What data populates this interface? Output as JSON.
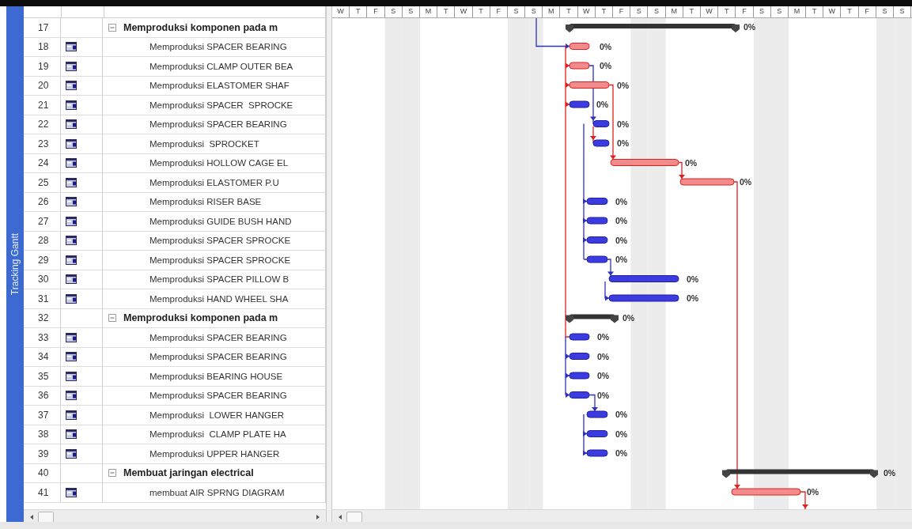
{
  "side_label": "Tracking Gantt",
  "timescale": [
    "W",
    "T",
    "F",
    "S",
    "S",
    "M",
    "T",
    "W",
    "T",
    "F",
    "S",
    "S",
    "M",
    "T",
    "W",
    "T",
    "F",
    "S",
    "S",
    "M",
    "T",
    "W",
    "T",
    "F",
    "S",
    "S",
    "M",
    "T",
    "W",
    "T",
    "F",
    "S",
    "S"
  ],
  "rows": [
    {
      "id": "17",
      "kind": "summary",
      "expanded": true,
      "name": "Memproduksi komponen pada m",
      "bar": {
        "kind": "summary",
        "label": "0%"
      }
    },
    {
      "id": "18",
      "kind": "task",
      "name": "Memproduksi SPACER BEARING",
      "bar": {
        "kind": "critical",
        "label": "0%"
      }
    },
    {
      "id": "19",
      "kind": "task",
      "name": "Memproduksi CLAMP OUTER BEA",
      "bar": {
        "kind": "critical",
        "label": "0%"
      }
    },
    {
      "id": "20",
      "kind": "task",
      "name": "Memproduksi ELASTOMER SHAF",
      "bar": {
        "kind": "critical",
        "label": "0%"
      }
    },
    {
      "id": "21",
      "kind": "task",
      "name": "Memproduksi SPACER  SPROCKE",
      "bar": {
        "kind": "normal",
        "label": "0%"
      }
    },
    {
      "id": "22",
      "kind": "task",
      "name": "Memproduksi SPACER BEARING",
      "bar": {
        "kind": "normal",
        "label": "0%"
      }
    },
    {
      "id": "23",
      "kind": "task",
      "name": "Memproduksi  SPROCKET",
      "bar": {
        "kind": "normal",
        "label": "0%"
      }
    },
    {
      "id": "24",
      "kind": "task",
      "name": "Memproduksi HOLLOW CAGE EL",
      "bar": {
        "kind": "critical",
        "label": "0%"
      }
    },
    {
      "id": "25",
      "kind": "task",
      "name": "Memproduksi ELASTOMER P.U",
      "bar": {
        "kind": "critical",
        "label": "0%"
      }
    },
    {
      "id": "26",
      "kind": "task",
      "name": "Memproduksi RISER BASE",
      "bar": {
        "kind": "normal",
        "label": "0%"
      }
    },
    {
      "id": "27",
      "kind": "task",
      "name": "Memproduksi GUIDE BUSH HAND",
      "bar": {
        "kind": "normal",
        "label": "0%"
      }
    },
    {
      "id": "28",
      "kind": "task",
      "name": "Memproduksi SPACER SPROCKE",
      "bar": {
        "kind": "normal",
        "label": "0%"
      }
    },
    {
      "id": "29",
      "kind": "task",
      "name": "Memproduksi SPACER SPROCKE",
      "bar": {
        "kind": "normal",
        "label": "0%"
      }
    },
    {
      "id": "30",
      "kind": "task",
      "name": "Memproduksi SPACER PILLOW B",
      "bar": {
        "kind": "normal",
        "label": "0%"
      }
    },
    {
      "id": "31",
      "kind": "task",
      "name": "Memproduksi HAND WHEEL SHA",
      "bar": {
        "kind": "normal",
        "label": "0%"
      }
    },
    {
      "id": "32",
      "kind": "summary",
      "expanded": true,
      "name": "Memproduksi komponen pada m",
      "bar": {
        "kind": "summary",
        "label": "0%"
      }
    },
    {
      "id": "33",
      "kind": "task",
      "name": "Memproduksi SPACER BEARING",
      "bar": {
        "kind": "normal",
        "label": "0%"
      }
    },
    {
      "id": "34",
      "kind": "task",
      "name": "Memproduksi SPACER BEARING",
      "bar": {
        "kind": "normal",
        "label": "0%"
      }
    },
    {
      "id": "35",
      "kind": "task",
      "name": "Memproduksi BEARING HOUSE",
      "bar": {
        "kind": "normal",
        "label": "0%"
      }
    },
    {
      "id": "36",
      "kind": "task",
      "name": "Memproduksi SPACER BEARING",
      "bar": {
        "kind": "normal",
        "label": "0%"
      }
    },
    {
      "id": "37",
      "kind": "task",
      "name": "Memproduksi  LOWER HANGER",
      "bar": {
        "kind": "normal",
        "label": "0%"
      }
    },
    {
      "id": "38",
      "kind": "task",
      "name": "Memproduksi  CLAMP PLATE HA",
      "bar": {
        "kind": "normal",
        "label": "0%"
      }
    },
    {
      "id": "39",
      "kind": "task",
      "name": "Memproduksi UPPER HANGER",
      "bar": {
        "kind": "normal",
        "label": "0%"
      }
    },
    {
      "id": "40",
      "kind": "summary",
      "expanded": true,
      "name": "Membuat jaringan electrical",
      "bar": {
        "kind": "summary",
        "label": "0%"
      }
    },
    {
      "id": "41",
      "kind": "task",
      "name": "membuat AIR SPRNG DIAGRAM",
      "bar": {
        "kind": "critical",
        "label": "0%"
      }
    }
  ]
}
